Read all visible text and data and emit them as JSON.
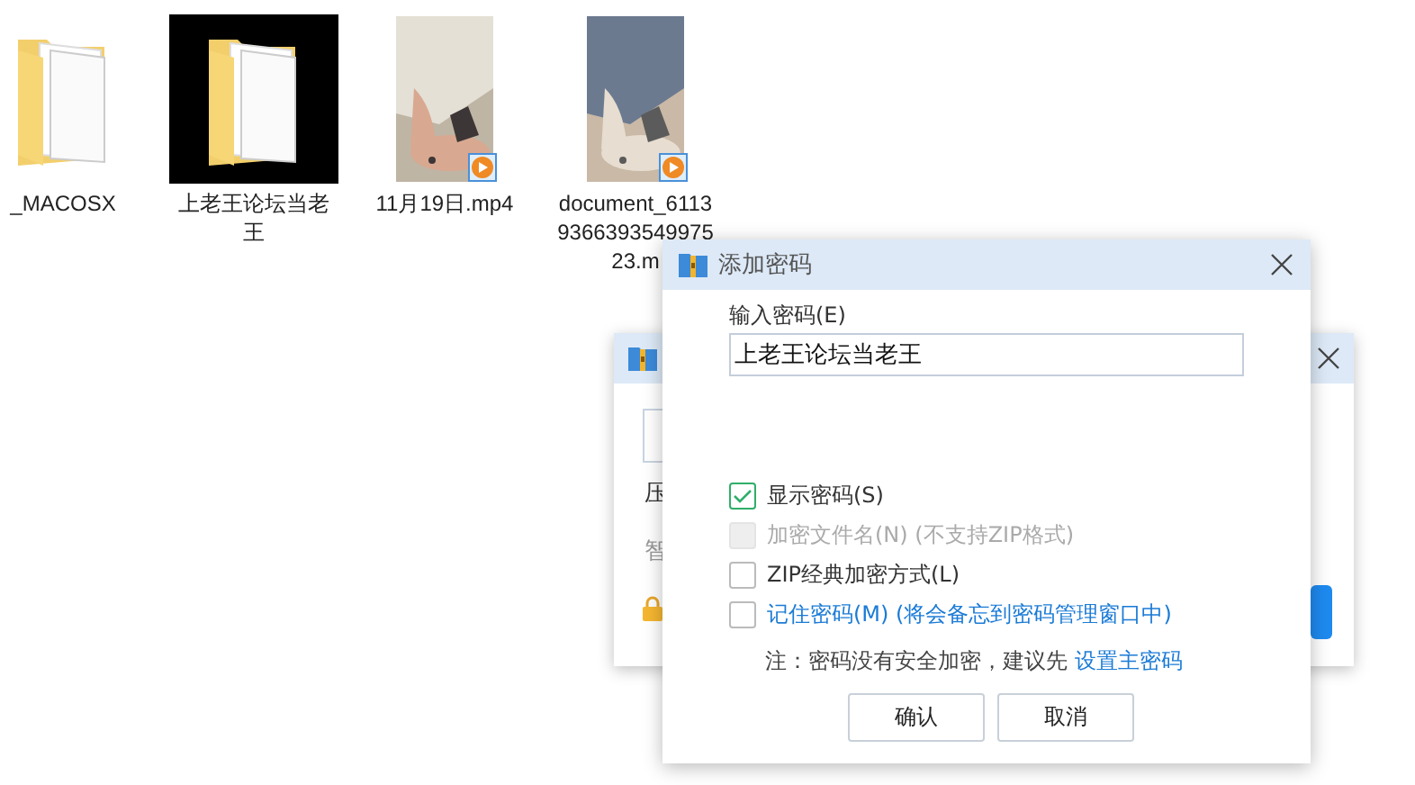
{
  "files": [
    {
      "name": "_MACOSX",
      "kind": "folder",
      "selected": false
    },
    {
      "name": "上老王论坛当老王",
      "kind": "folder",
      "selected": true
    },
    {
      "name": "11月19日.mp4",
      "kind": "video",
      "selected": false
    },
    {
      "name_lines": [
        "document_6113",
        "9366393549975",
        "23.m"
      ],
      "kind": "video",
      "selected": false
    }
  ],
  "background_dialog": {
    "labels": [
      "压",
      "智"
    ]
  },
  "dialog": {
    "title": "添加密码",
    "password_label": "输入密码(E)",
    "password_value": "上老王论坛当老王",
    "options": [
      {
        "label": "显示密码(S)",
        "checked": true,
        "disabled": false,
        "kind": "plain"
      },
      {
        "label": "加密文件名(N) (不支持ZIP格式)",
        "checked": false,
        "disabled": true,
        "kind": "plain"
      },
      {
        "label": "ZIP经典加密方式(L)",
        "checked": false,
        "disabled": false,
        "kind": "plain"
      },
      {
        "label": "记住密码(M) (将会备忘到密码管理窗口中)",
        "checked": false,
        "disabled": false,
        "kind": "link"
      }
    ],
    "note": "注：密码没有安全加密，建议先",
    "note_link": "设置主密码",
    "buttons": [
      "确认",
      "取消"
    ]
  }
}
